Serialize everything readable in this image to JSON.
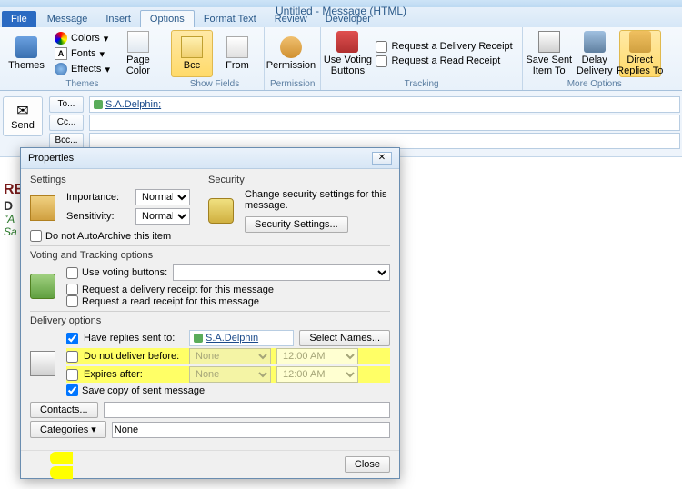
{
  "window": {
    "title": "Untitled - Message (HTML)"
  },
  "tabs": {
    "file": "File",
    "message": "Message",
    "insert": "Insert",
    "options": "Options",
    "format_text": "Format Text",
    "review": "Review",
    "developer": "Developer",
    "active": "Options"
  },
  "ribbon": {
    "themes": {
      "label": "Themes",
      "themes_btn": "Themes",
      "colors": "Colors",
      "fonts": "Fonts",
      "effects": "Effects",
      "page_color": "Page\nColor"
    },
    "show_fields": {
      "label": "Show Fields",
      "bcc": "Bcc",
      "from": "From"
    },
    "permission": {
      "label": "Permission",
      "permission": "Permission"
    },
    "tracking": {
      "label": "Tracking",
      "voting": "Use Voting\nButtons",
      "delivery_receipt": "Request a Delivery Receipt",
      "read_receipt": "Request a Read Receipt"
    },
    "more_options": {
      "label": "More Options",
      "save_sent": "Save Sent\nItem To",
      "delay": "Delay\nDelivery",
      "direct": "Direct\nReplies To"
    }
  },
  "compose": {
    "send": "Send",
    "to_btn": "To...",
    "cc_btn": "Cc...",
    "bcc_btn": "Bcc...",
    "to_value": "S.A.Delphin;"
  },
  "backdrop": {
    "r": "RE",
    "d": "D",
    "q1": "\"A",
    "q2": "Sa"
  },
  "dialog": {
    "title": "Properties",
    "close_x": "✕",
    "sections": {
      "settings": "Settings",
      "security": "Security",
      "voting": "Voting and Tracking options",
      "delivery": "Delivery options"
    },
    "settings": {
      "importance_lbl": "Importance:",
      "importance_val": "Normal",
      "sensitivity_lbl": "Sensitivity:",
      "sensitivity_val": "Normal",
      "autoarchive": "Do not AutoArchive this item"
    },
    "security": {
      "text": "Change security settings for this message.",
      "button": "Security Settings..."
    },
    "voting": {
      "use_voting": "Use voting buttons:",
      "delivery_receipt": "Request a delivery receipt for this message",
      "read_receipt": "Request a read receipt for this message"
    },
    "delivery": {
      "have_replies": "Have replies sent to:",
      "replies_value": "S.A.Delphin",
      "select_names": "Select Names...",
      "no_deliver_before": "Do not deliver before:",
      "expires_after": "Expires after:",
      "date_none": "None",
      "time_default": "12:00 AM",
      "save_copy": "Save copy of sent message",
      "contacts": "Contacts...",
      "categories": "Categories",
      "categories_val": "None"
    },
    "close": "Close"
  }
}
